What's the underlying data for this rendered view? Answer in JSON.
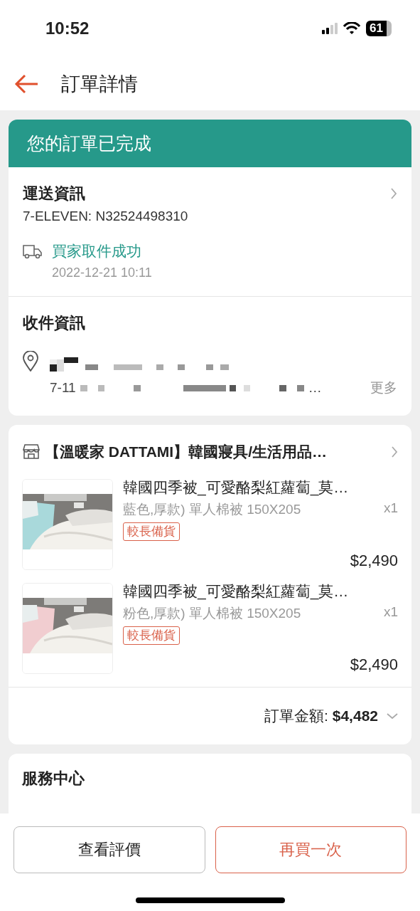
{
  "status_bar": {
    "time": "10:52",
    "battery": "61"
  },
  "header": {
    "title": "訂單詳情"
  },
  "order_status": {
    "title": "您的訂單已完成"
  },
  "shipping": {
    "title": "運送資訊",
    "tracking": "7-ELEVEN: N32524498310",
    "event": "買家取件成功",
    "event_time": "2022-12-21 10:11"
  },
  "recipient": {
    "title": "收件資訊",
    "address_line_2": "7-11",
    "ellipsis": "…",
    "more": "更多"
  },
  "shop": {
    "name": "【溫暖家 DATTAMI】韓國寢具/生活用品…",
    "items": [
      {
        "name": "韓國四季被_可愛酪梨紅蘿蔔_莫…",
        "variant": "藍色,厚款) 單人棉被 150X205",
        "quantity": "x1",
        "tag": "較長備貨",
        "price": "$2,490"
      },
      {
        "name": "韓國四季被_可愛酪梨紅蘿蔔_莫…",
        "variant": "粉色,厚款) 單人棉被 150X205",
        "quantity": "x1",
        "tag": "較長備貨",
        "price": "$2,490"
      }
    ],
    "total": "訂單金額: **$4,482**"
  },
  "service_center": {
    "title": "服務中心"
  },
  "buttons": [
    {
      "label": "查看評價",
      "kind": "secondary"
    },
    {
      "label": "再買一次",
      "kind": "primary"
    }
  ]
}
